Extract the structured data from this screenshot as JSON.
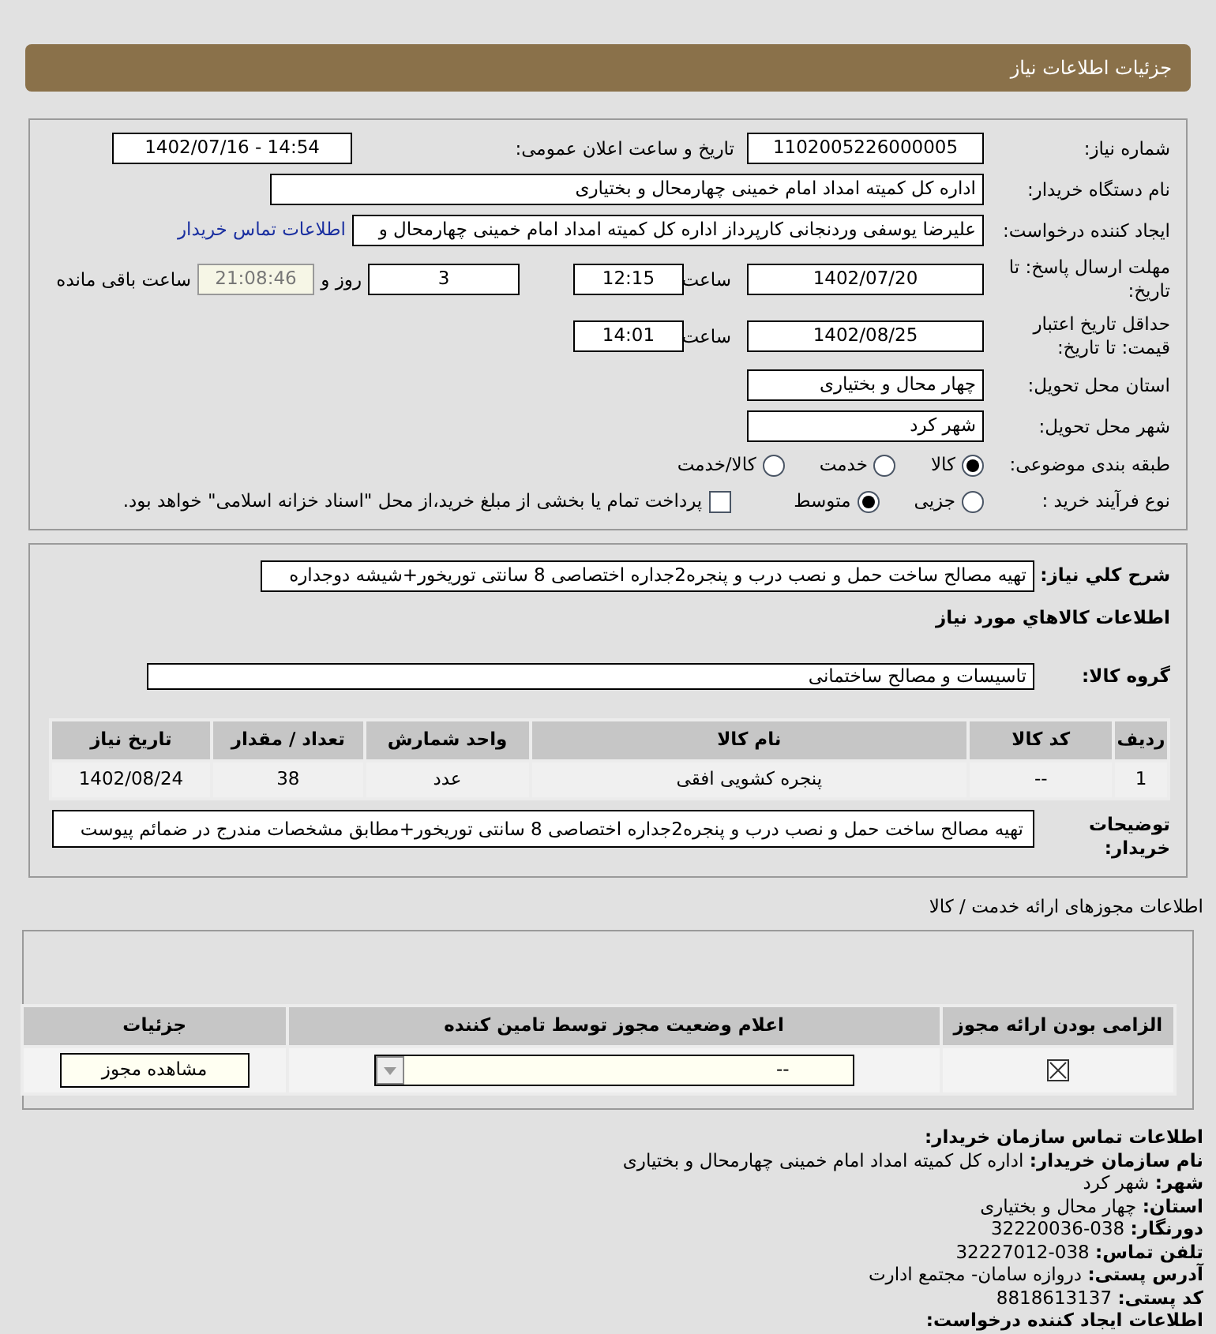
{
  "header": {
    "title": "جزئیات اطلاعات نیاز"
  },
  "need_number": {
    "label": "شماره نیاز:",
    "value": "1102005226000005"
  },
  "announce": {
    "label": "تاریخ و ساعت اعلان عمومی:",
    "value": "1402/07/16 - 14:54"
  },
  "buyer_org": {
    "label": "نام دستگاه خریدار:",
    "value": "اداره کل کمیته امداد امام خمینی چهارمحال و بختیاری"
  },
  "requester": {
    "label": "ایجاد کننده درخواست:",
    "value": "علیرضا یوسفی وردنجانی کارپرداز اداره کل کمیته امداد امام خمینی چهارمحال و",
    "link": "اطلاعات تماس خریدار"
  },
  "deadline": {
    "label": "مهلت ارسال پاسخ: تا تاریخ:",
    "date": "1402/07/20",
    "time_label": "ساعت",
    "time": "12:15",
    "days": "3",
    "days_label": "روز و",
    "remaining": "21:08:46",
    "remaining_label": "ساعت باقی مانده"
  },
  "validity": {
    "label": "حداقل تاریخ اعتبار قیمت: تا تاریخ:",
    "date": "1402/08/25",
    "time_label": "ساعت",
    "time": "14:01"
  },
  "province": {
    "label": "استان محل تحویل:",
    "value": "چهار محال و بختیاری"
  },
  "city": {
    "label": "شهر محل تحویل:",
    "value": "شهر کرد"
  },
  "category": {
    "label": "طبقه بندی موضوعی:",
    "options": [
      {
        "label": "کالا",
        "selected": true
      },
      {
        "label": "خدمت",
        "selected": false
      },
      {
        "label": "کالا/خدمت",
        "selected": false
      }
    ]
  },
  "process": {
    "label": "نوع فرآیند خرید :",
    "options": [
      {
        "label": "جزیی",
        "selected": false
      },
      {
        "label": "متوسط",
        "selected": true
      }
    ],
    "payment": {
      "checked": false,
      "label": "پرداخت تمام یا بخشی از مبلغ خرید،از محل \"اسناد خزانه اسلامی\" خواهد بود."
    }
  },
  "summary": {
    "label": "شرح کلي نیاز:",
    "value": "تهیه مصالح ساخت حمل و نصب درب و پنجره2جداره اختصاصی 8 سانتی توریخور+شیشه دوجداره"
  },
  "goods_title": "اطلاعات کالاهاي مورد نیاز",
  "goods_group": {
    "label": "گروه کالا:",
    "value": "تاسیسات و مصالح ساختمانی"
  },
  "goods_table": {
    "columns": [
      "ردیف",
      "کد کالا",
      "نام کالا",
      "واحد شمارش",
      "تعداد / مقدار",
      "تاریخ نیاز"
    ],
    "rows": [
      [
        "1",
        "--",
        "پنجره کشویی افقی",
        "عدد",
        "38",
        "1402/08/24"
      ]
    ]
  },
  "buyer_notes": {
    "label": "توضیحات خریدار:",
    "value": "تهیه مصالح ساخت حمل و نصب درب و پنجره2جداره اختصاصی 8 سانتی توریخور+مطابق مشخصات مندرج در ضمائم پیوست"
  },
  "permits": {
    "title": "اطلاعات مجوزهای ارائه خدمت / کالا",
    "columns": [
      "الزامی بودن ارائه مجوز",
      "اعلام وضعیت مجوز توسط تامین کننده",
      "جزئیات"
    ],
    "rows": [
      {
        "required": true,
        "status": "--",
        "button": "مشاهده مجوز"
      }
    ]
  },
  "contact": {
    "title": "اطلاعات تماس سازمان خریدار:",
    "lines": [
      {
        "label": "نام سازمان خریدار:",
        "value": "اداره کل کمیته امداد امام خمینی چهارمحال و بختیاری"
      },
      {
        "label": "شهر:",
        "value": "شهر کرد"
      },
      {
        "label": "استان:",
        "value": "چهار محال و بختیاری"
      },
      {
        "label": "دورنگار:",
        "value": "038-32220036"
      },
      {
        "label": "تلفن تماس:",
        "value": "038-32227012"
      },
      {
        "label": "آدرس پستی:",
        "value": "دروازه سامان- مجتمع ادارت"
      },
      {
        "label": "کد پستی:",
        "value": "8818613137"
      }
    ],
    "next_title": "اطلاعات ایجاد کننده درخواست:"
  }
}
